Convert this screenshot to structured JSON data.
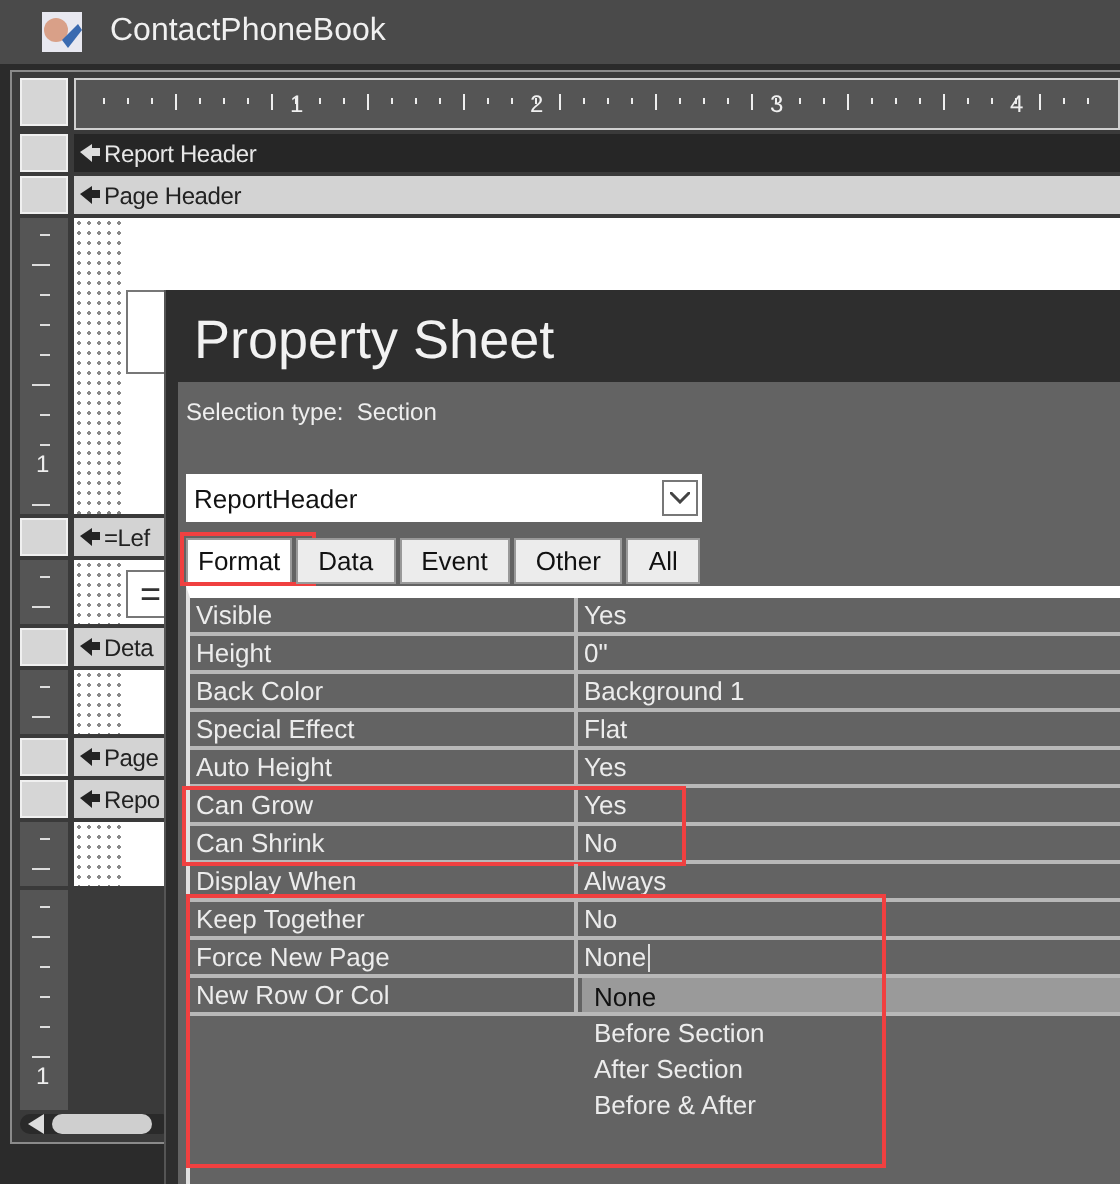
{
  "window": {
    "title": "ContactPhoneBook"
  },
  "designer": {
    "ruler_labels": [
      "1",
      "2",
      "3",
      "4"
    ],
    "sections": [
      {
        "label": "Report Header",
        "selected": true
      },
      {
        "label": "Page Header",
        "selected": false,
        "ruler_label": "1"
      },
      {
        "label": "=Lef",
        "selected": false,
        "controls": [
          "="
        ]
      },
      {
        "label": "Deta",
        "selected": false
      },
      {
        "label": "Page",
        "selected": false
      },
      {
        "label": "Repo",
        "selected": false
      }
    ],
    "lower_ruler_label": "1"
  },
  "property_sheet": {
    "title": "Property Sheet",
    "selection_label": "Selection type:",
    "selection_type": "Section",
    "object": "ReportHeader",
    "tabs": [
      {
        "label": "Format",
        "selected": true,
        "highlighted": true
      },
      {
        "label": "Data",
        "selected": false,
        "highlighted": false
      },
      {
        "label": "Event",
        "selected": false,
        "highlighted": false
      },
      {
        "label": "Other",
        "selected": false,
        "highlighted": false
      },
      {
        "label": "All",
        "selected": false,
        "highlighted": false
      }
    ],
    "groups": [
      {
        "highlighted": false,
        "rows": [
          {
            "label": "Visible",
            "value": "Yes"
          },
          {
            "label": "Height",
            "value": "0\""
          },
          {
            "label": "Back Color",
            "value": "Background 1"
          },
          {
            "label": "Special Effect",
            "value": "Flat"
          },
          {
            "label": "Auto Height",
            "value": "Yes"
          }
        ]
      },
      {
        "highlighted": true,
        "rows": [
          {
            "label": "Can Grow",
            "value": "Yes"
          },
          {
            "label": "Can Shrink",
            "value": "No"
          }
        ]
      },
      {
        "highlighted": false,
        "rows": [
          {
            "label": "Display When",
            "value": "Always"
          }
        ]
      },
      {
        "highlighted": true,
        "rows": [
          {
            "label": "Keep Together",
            "value": "No"
          },
          {
            "label": "Force New Page",
            "value": "None",
            "editing": true,
            "options": [
              {
                "label": "None",
                "selected": true
              },
              {
                "label": "Before Section",
                "selected": false
              },
              {
                "label": "After Section",
                "selected": false
              },
              {
                "label": "Before & After",
                "selected": false
              }
            ]
          },
          {
            "label": "New Row Or Col"
          }
        ]
      }
    ]
  }
}
